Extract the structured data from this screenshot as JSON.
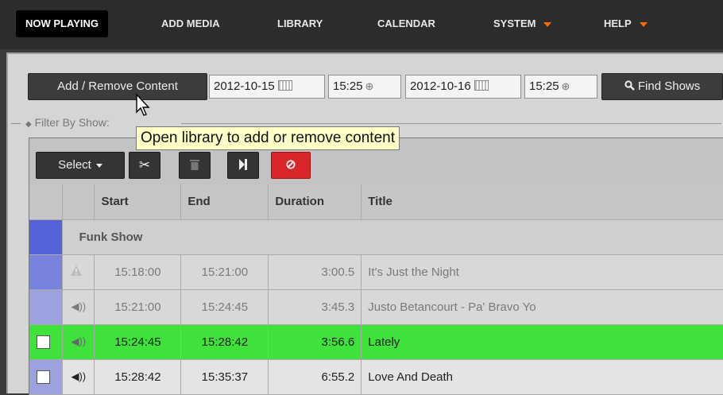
{
  "nav": {
    "items": [
      {
        "label": "NOW PLAYING",
        "active": true
      },
      {
        "label": "ADD MEDIA"
      },
      {
        "label": "LIBRARY"
      },
      {
        "label": "CALENDAR"
      },
      {
        "label": "SYSTEM",
        "dropdown": true
      },
      {
        "label": "HELP",
        "dropdown": true
      }
    ]
  },
  "controls": {
    "add_remove_label": "Add / Remove Content",
    "start_date": "2012-10-15",
    "start_time": "15:25",
    "end_date": "2012-10-16",
    "end_time": "15:25",
    "find_shows_label": "Find Shows",
    "filter_label": "Filter By Show:"
  },
  "toolbar": {
    "select_label": "Select"
  },
  "table": {
    "headers": [
      "Start",
      "End",
      "Duration",
      "Title"
    ],
    "show_name": "Funk Show",
    "rows": [
      {
        "start": "15:18:00",
        "end": "15:21:00",
        "duration": "3:00.5",
        "title": "It's Just the Night",
        "state": "past",
        "icon": "warning-icon"
      },
      {
        "start": "15:21:00",
        "end": "15:24:45",
        "duration": "3:45.3",
        "title": "Justo Betancourt - Pa' Bravo Yo",
        "state": "past",
        "icon": "speaker-icon"
      },
      {
        "start": "15:24:45",
        "end": "15:28:42",
        "duration": "3:56.6",
        "title": "Lately",
        "state": "now",
        "icon": "speaker-icon"
      },
      {
        "start": "15:28:42",
        "end": "15:35:37",
        "duration": "6:55.2",
        "title": "Love And Death",
        "state": "next",
        "icon": "speaker-icon"
      }
    ]
  },
  "tooltip": "Open library to add or remove content",
  "colors": {
    "playing_row": "#3fe23b",
    "show_marker": "#5562d8",
    "cancel_button": "#d9262b",
    "dropdown_caret": "#ff6a00"
  }
}
